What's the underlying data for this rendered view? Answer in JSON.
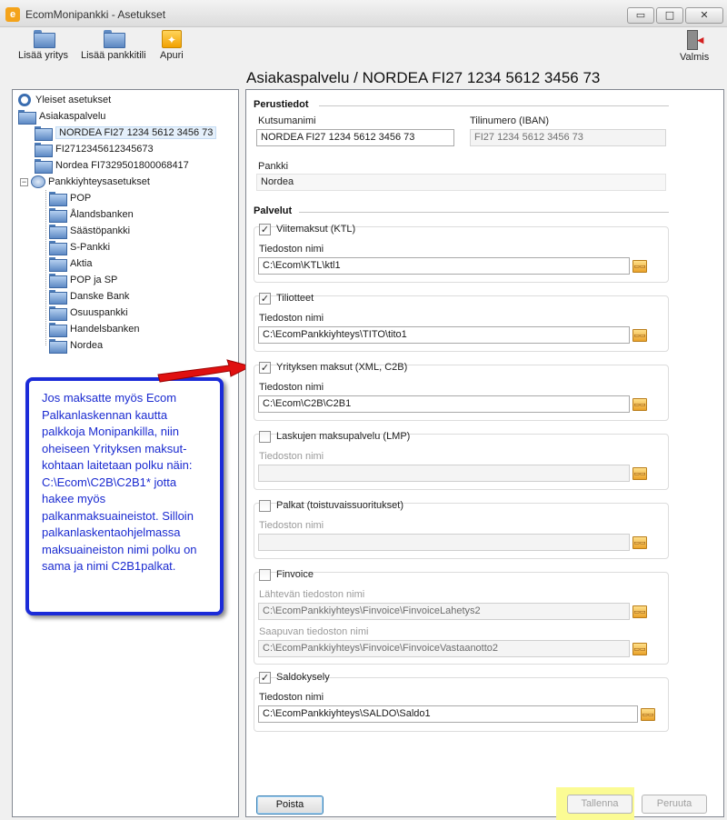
{
  "window": {
    "title": "EcomMonipankki - Asetukset",
    "app_icon_letter": "e",
    "minimize": "▭",
    "maximize": "□",
    "close": "✕"
  },
  "toolbar": {
    "add_company": "Lisää yritys",
    "add_account": "Lisää pankkitili",
    "wizard": "Apuri",
    "done": "Valmis"
  },
  "heading": "Asiakaspalvelu / NORDEA FI27 1234 5612 3456 73",
  "tree": {
    "general": "Yleiset asetukset",
    "customer_service": "Asiakaspalvelu",
    "accounts": [
      "NORDEA FI27 1234 5612 3456 73",
      "FI2712345612345673",
      "Nordea FI7329501800068417"
    ],
    "bank_settings": "Pankkiyhteysasetukset",
    "expander": "−",
    "banks": [
      "POP",
      "Ålandsbanken",
      "Säästöpankki",
      "S-Pankki",
      "Aktia",
      "POP ja SP",
      "Danske Bank",
      "Osuuspankki",
      "Handelsbanken",
      "Nordea"
    ]
  },
  "callout": {
    "text": "Jos maksatte myös Ecom Palkanlaskennan kautta palkkoja Monipankilla, niin oheiseen Yrityksen maksut-kohtaan laitetaan polku näin: C:\\Ecom\\C2B\\C2B1* jotta hakee myös palkanmaksuaineistot. Silloin palkanlaskentaohjelmassa maksuaineiston nimi polku on sama ja nimi C2B1palkat."
  },
  "basic": {
    "section": "Perustiedot",
    "name_label": "Kutsumanimi",
    "name_value": "NORDEA FI27 1234 5612 3456 73",
    "iban_label": "Tilinumero (IBAN)",
    "iban_value": "FI27 1234 5612 3456 73",
    "bank_label": "Pankki",
    "bank_value": "Nordea"
  },
  "services": {
    "section": "Palvelut",
    "file_label": "Tiedoston nimi",
    "check_mark": "✓",
    "browse_icon": "▭▭",
    "ktl": {
      "label": "Viitemaksut (KTL)",
      "checked": true,
      "path": "C:\\Ecom\\KTL\\ktl1"
    },
    "tito": {
      "label": "Tiliotteet",
      "checked": true,
      "path": "C:\\EcomPankkiyhteys\\TITO\\tito1"
    },
    "c2b": {
      "label": "Yrityksen maksut (XML, C2B)",
      "checked": true,
      "path": "C:\\Ecom\\C2B\\C2B1"
    },
    "lmp": {
      "label": "Laskujen maksupalvelu (LMP)",
      "checked": false,
      "path": ""
    },
    "salary": {
      "label": "Palkat (toistuvaissuoritukset)",
      "checked": false,
      "path": ""
    },
    "finvoice": {
      "label": "Finvoice",
      "checked": false,
      "out_label": "Lähtevän tiedoston nimi",
      "out_path": "C:\\EcomPankkiyhteys\\Finvoice\\FinvoiceLahetys2",
      "in_label": "Saapuvan tiedoston nimi",
      "in_path": "C:\\EcomPankkiyhteys\\Finvoice\\FinvoiceVastaanotto2"
    },
    "saldo": {
      "label": "Saldokysely",
      "checked": true,
      "path": "C:\\EcomPankkiyhteys\\SALDO\\Saldo1"
    }
  },
  "buttons": {
    "delete": "Poista",
    "save": "Tallenna",
    "cancel": "Peruuta"
  },
  "colors": {
    "callout_border": "#1b2bd8",
    "arrow": "#e01010",
    "highlight": "#fbfb94"
  }
}
